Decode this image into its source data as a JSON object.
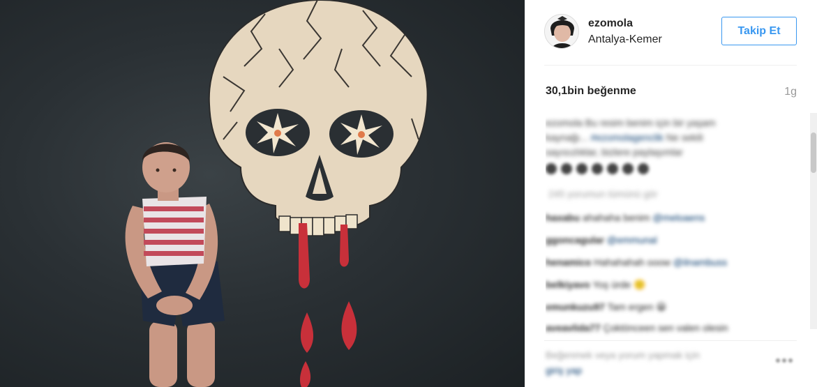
{
  "header": {
    "username": "ezomola",
    "location": "Antalya-Kemer",
    "follow_label": "Takip Et"
  },
  "stats": {
    "likes": "30,1bin beğenme",
    "time": "1g"
  },
  "caption": {
    "line1": "ezomola Bu resim benim için bir yaşam",
    "line2_pre": "kaynağı... ",
    "line2_link": "#ezomolagenclik",
    "line2_post": " Ne sekili",
    "line3": "sayısızlıklar, bizlere paylaşımlar"
  },
  "comments_more": "245 yorumun tümünü gör",
  "comments": [
    {
      "user": "haxabu",
      "text": "ahahaha benim ",
      "mention": "@meloaens"
    },
    {
      "user": "ggoncagular",
      "text": "",
      "mention": "@emmunal"
    },
    {
      "user": "henamico",
      "text": "Hahahahah ooow ",
      "mention": "@ilnambuss"
    },
    {
      "user": "belkiyavo",
      "text": "Yoş ürde 🙂",
      "mention": ""
    },
    {
      "user": "emunkuzu97",
      "text": "Tam ergen 😀",
      "mention": ""
    },
    {
      "user": "aveavlida77",
      "text": "Çoktönceen sen valen olesin",
      "mention": ""
    }
  ],
  "footer": {
    "login_text": "Beğenmek veya yorum yapmak için",
    "login_link": "giriş yap"
  },
  "icons": {
    "more": "more-options-icon",
    "avatar": "avatar"
  },
  "colors": {
    "accent": "#3897f0",
    "link": "#003569",
    "muted": "#999999"
  }
}
